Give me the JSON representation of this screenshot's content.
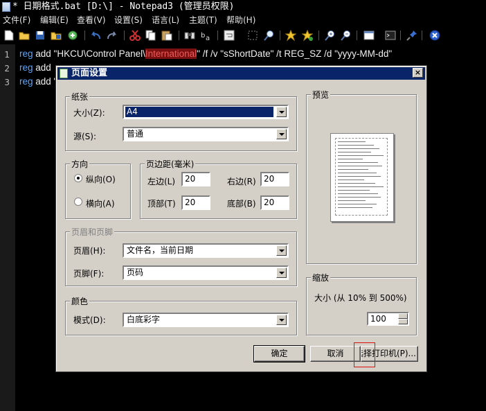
{
  "window": {
    "title": "* 日期格式.bat [D:\\] - Notepad3 (管理员权限)"
  },
  "menu": [
    "文件(F)",
    "编辑(E)",
    "查看(V)",
    "设置(S)",
    "语言(L)",
    "主题(T)",
    "帮助(H)"
  ],
  "toolbar_icons": [
    "new-file-icon",
    "open-folder-icon",
    "save-icon",
    "save-as-icon",
    "browse-icon",
    "undo-icon",
    "redo-icon",
    "cut-icon",
    "copy-icon",
    "paste-icon",
    "find-icon",
    "replace-icon",
    "wrap-icon",
    "select-icon",
    "zoom-search-icon",
    "star-icon",
    "star-add-icon",
    "zoom-in-icon",
    "zoom-out-icon",
    "window-icon",
    "terminal-icon",
    "pin-icon",
    "exit-icon"
  ],
  "editor": {
    "lines": [
      {
        "num": "1",
        "kw": "reg",
        "pre": " add \"HKCU\\Control Panel\\",
        "hl": "International",
        "post": "\" /f /v \"sShortDate\" /t REG_SZ /d \"yyyy-MM-dd\""
      },
      {
        "num": "2",
        "kw": "reg",
        "pre": " add",
        "hl": "",
        "post": ""
      },
      {
        "num": "3",
        "kw": "reg",
        "pre": " add \"",
        "hl": "",
        "post": ""
      }
    ]
  },
  "dialog": {
    "title": "页面设置",
    "close": "×",
    "paper": {
      "group_label": "纸张",
      "size_label": "大小(Z):",
      "size_value": "A4",
      "source_label": "源(S):",
      "source_value": "普通"
    },
    "orientation": {
      "group_label": "方向",
      "portrait": "纵向(O)",
      "landscape": "横向(A)",
      "selected": "portrait"
    },
    "margins": {
      "group_label": "页边距(毫米)",
      "left_label": "左边(L)",
      "left_value": "20",
      "right_label": "右边(R)",
      "right_value": "20",
      "top_label": "顶部(T)",
      "top_value": "20",
      "bottom_label": "底部(B)",
      "bottom_value": "20"
    },
    "header_footer": {
      "group_label": "页眉和页脚",
      "header_label": "页眉(H):",
      "header_value": "文件名，当前日期",
      "footer_label": "页脚(F):",
      "footer_value": "页码"
    },
    "color": {
      "group_label": "颜色",
      "mode_label": "模式(D):",
      "mode_value": "白底彩字"
    },
    "preview": {
      "group_label": "预览"
    },
    "zoom": {
      "group_label": "缩放",
      "text": "大小 (从 10% 到 500%)",
      "value": "100"
    },
    "buttons": {
      "ok": "确定",
      "cancel": "取消",
      "printer": "选择打印机(P)..."
    }
  }
}
